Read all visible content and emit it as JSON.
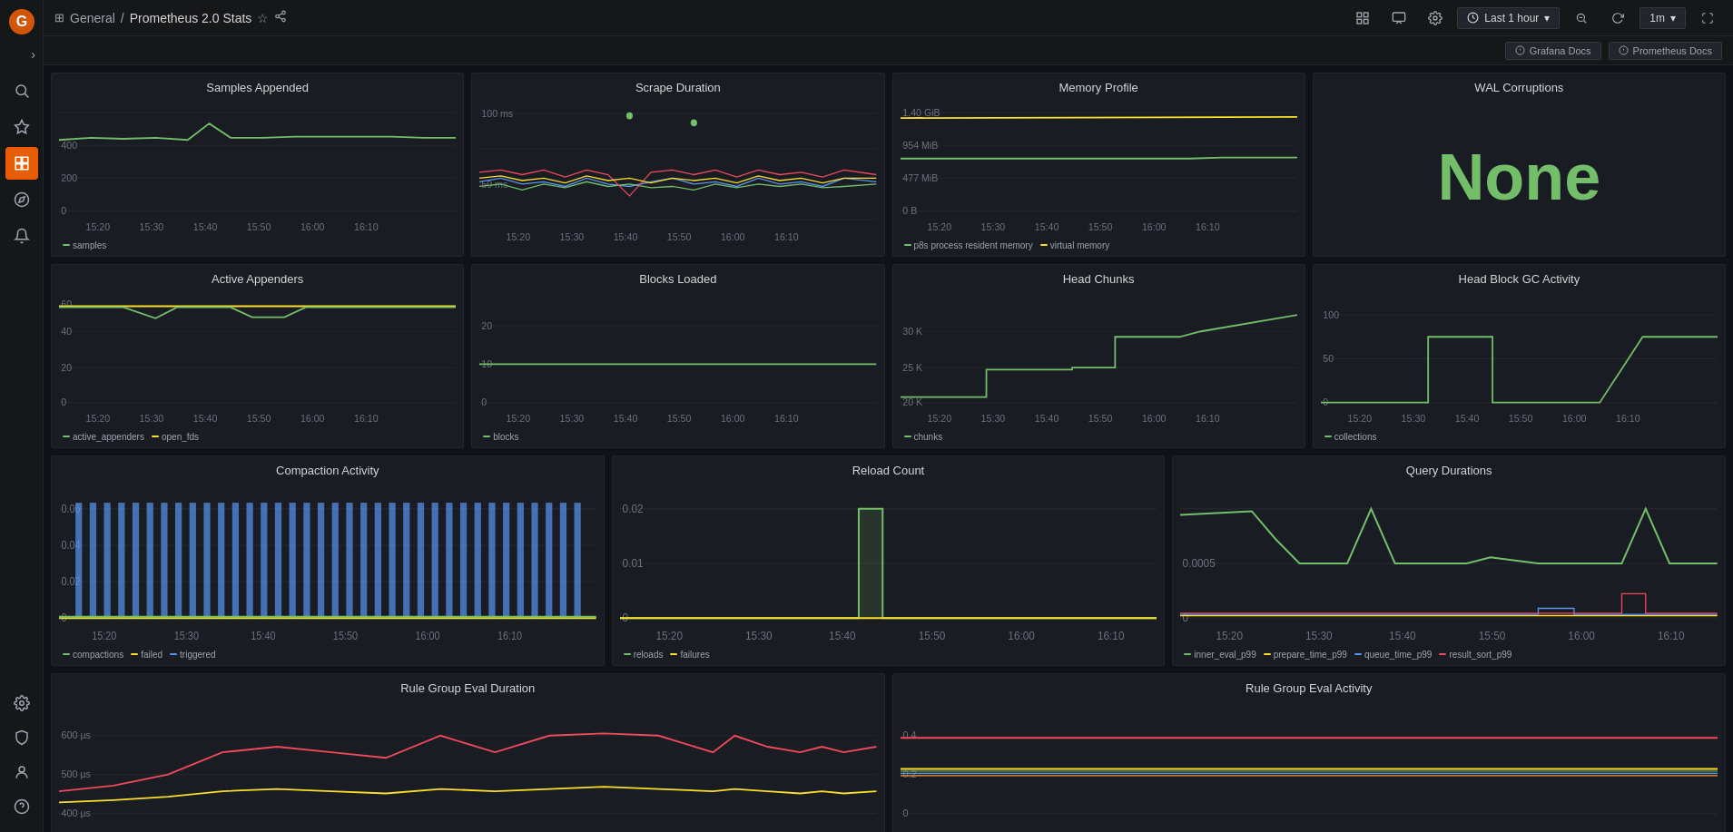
{
  "app": {
    "title": "General / Prometheus 2.0 Stats"
  },
  "breadcrumb": {
    "parent": "General",
    "separator": "/",
    "title": "Prometheus 2.0 Stats"
  },
  "topbar": {
    "star_label": "★",
    "share_label": "share",
    "time_range": "Last 1 hour",
    "interval": "1m"
  },
  "docs_buttons": {
    "grafana": "Grafana Docs",
    "prometheus": "Prometheus Docs"
  },
  "panels": {
    "row1": [
      {
        "id": "samples-appended",
        "title": "Samples Appended",
        "legend": [
          {
            "label": "samples",
            "color": "#73bf69"
          }
        ]
      },
      {
        "id": "scrape-duration",
        "title": "Scrape Duration",
        "legend": []
      },
      {
        "id": "memory-profile",
        "title": "Memory Profile",
        "legend": [
          {
            "label": "p8s process resident memory",
            "color": "#73bf69"
          },
          {
            "label": "virtual memory",
            "color": "#fade2a"
          }
        ]
      },
      {
        "id": "wal-corruptions",
        "title": "WAL Corruptions",
        "value": "None"
      }
    ],
    "row2": [
      {
        "id": "active-appenders",
        "title": "Active Appenders",
        "legend": [
          {
            "label": "active_appenders",
            "color": "#73bf69"
          },
          {
            "label": "open_fds",
            "color": "#fade2a"
          }
        ]
      },
      {
        "id": "blocks-loaded",
        "title": "Blocks Loaded",
        "legend": [
          {
            "label": "blocks",
            "color": "#73bf69"
          }
        ]
      },
      {
        "id": "head-chunks",
        "title": "Head Chunks",
        "legend": [
          {
            "label": "chunks",
            "color": "#73bf69"
          }
        ]
      },
      {
        "id": "head-block-gc",
        "title": "Head Block GC Activity",
        "legend": [
          {
            "label": "collections",
            "color": "#73bf69"
          }
        ]
      }
    ],
    "row3": [
      {
        "id": "compaction-activity",
        "title": "Compaction Activity",
        "legend": [
          {
            "label": "compactions",
            "color": "#73bf69"
          },
          {
            "label": "failed",
            "color": "#fade2a"
          },
          {
            "label": "triggered",
            "color": "#5794f2"
          }
        ]
      },
      {
        "id": "reload-count",
        "title": "Reload Count",
        "legend": [
          {
            "label": "reloads",
            "color": "#73bf69"
          },
          {
            "label": "failures",
            "color": "#fade2a"
          }
        ]
      },
      {
        "id": "query-durations",
        "title": "Query Durations",
        "legend": [
          {
            "label": "inner_eval_p99",
            "color": "#73bf69"
          },
          {
            "label": "prepare_time_p99",
            "color": "#fade2a"
          },
          {
            "label": "queue_time_p99",
            "color": "#5794f2"
          },
          {
            "label": "result_sort_p99",
            "color": "#f2495c"
          }
        ]
      }
    ],
    "row4": [
      {
        "id": "rule-group-eval-duration",
        "title": "Rule Group Eval Duration",
        "legend": []
      },
      {
        "id": "rule-group-eval-activity",
        "title": "Rule Group Eval Activity",
        "legend": []
      }
    ]
  },
  "x_ticks": [
    "15:20",
    "15:30",
    "15:40",
    "15:50",
    "16:00",
    "16:10"
  ],
  "colors": {
    "green": "#73bf69",
    "yellow": "#fade2a",
    "blue": "#5794f2",
    "red": "#f2495c",
    "orange": "#ff7b25"
  }
}
